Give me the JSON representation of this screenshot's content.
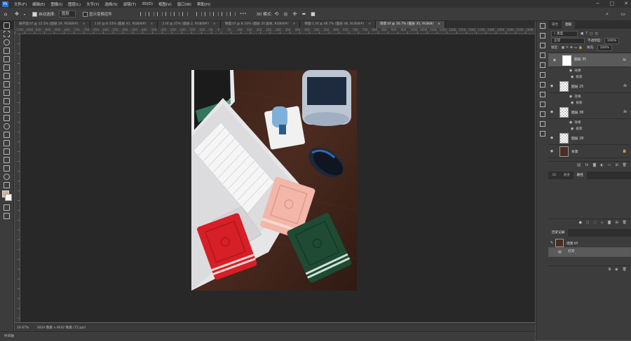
{
  "menu": {
    "app_icon": "Ps",
    "items": [
      "文件(F)",
      "编辑(E)",
      "图像(I)",
      "图层(L)",
      "文字(Y)",
      "选择(S)",
      "滤镜(T)",
      "3D(D)",
      "视图(V)",
      "窗口(W)",
      "帮助(H)"
    ]
  },
  "options_bar": {
    "auto_select_label": "自动选择:",
    "auto_select_value": "图层",
    "show_transform_label": "显示变换控件",
    "mode_3d_label": "3D 模式:",
    "more": "•••"
  },
  "tabs": [
    {
      "label": "展开图.tif @ 12.5% (图层 29, RGB/8#)",
      "active": false
    },
    {
      "label": "1.tif @ 8.33% (图层 41, RGB/8#)",
      "active": false
    },
    {
      "label": "2.tif @ 25% (图层 2, RGB/8#)",
      "active": false
    },
    {
      "label": "侧面.tif @ 8.33% (图层 20 副本, RGB/8#)",
      "active": false
    },
    {
      "label": "侧面-1.tif @ 66.7% (图层 48, RGB/8#)",
      "active": false
    },
    {
      "label": "场景.tif @ 16.7% (图层 35, RGB/8)",
      "active": true
    }
  ],
  "tab_close": "×",
  "ruler_labels": [
    "-1500",
    "-1000",
    "-950",
    "-900",
    "-850",
    "-800",
    "-750",
    "-700",
    "-650",
    "-600",
    "-550",
    "-500",
    "-450",
    "-400",
    "-350",
    "-300",
    "-250",
    "-200",
    "-150",
    "-100",
    "-50",
    "0",
    "50",
    "100",
    "150",
    "200",
    "250",
    "300",
    "350",
    "400",
    "450",
    "500",
    "550",
    "600",
    "650",
    "700",
    "750",
    "800",
    "850",
    "900",
    "950",
    "1000",
    "1050",
    "1100",
    "1150",
    "1200",
    "1250",
    "1300",
    "1350",
    "1400",
    "1450",
    "1500",
    "1550",
    "1600"
  ],
  "status": {
    "zoom": "16.67%",
    "doc_info": "3024 像素 x 4032 像素 (72 ppi)"
  },
  "timeline_label": "时间轴",
  "panels": {
    "top_tabs": [
      "属性",
      "图层"
    ],
    "kind_label": "类型",
    "blend_mode": "正常",
    "opacity_label": "不透明度:",
    "opacity_value": "100%",
    "lock_label": "锁定:",
    "fill_label": "填充:",
    "fill_value": "100%",
    "layers": [
      {
        "name": "图层 35",
        "fx": "fx",
        "selected": true,
        "effects_label": "效果",
        "effect": "投影"
      },
      {
        "name": "图层 25",
        "fx": "fx",
        "selected": false,
        "effects_label": "效果",
        "effect": "投影"
      },
      {
        "name": "图层 38",
        "fx": "fx",
        "selected": false,
        "effects_label": "效果",
        "effect": "投影"
      },
      {
        "name": "图层 28",
        "fx": "",
        "selected": false
      },
      {
        "name": "背景",
        "fx": "",
        "selected": false,
        "locked": true
      }
    ],
    "mid_tabs": [
      "3D",
      "通道",
      "路径"
    ],
    "history_title": "历史记录",
    "history_snapshot": "场景.tif",
    "history_items": [
      "打开"
    ]
  }
}
